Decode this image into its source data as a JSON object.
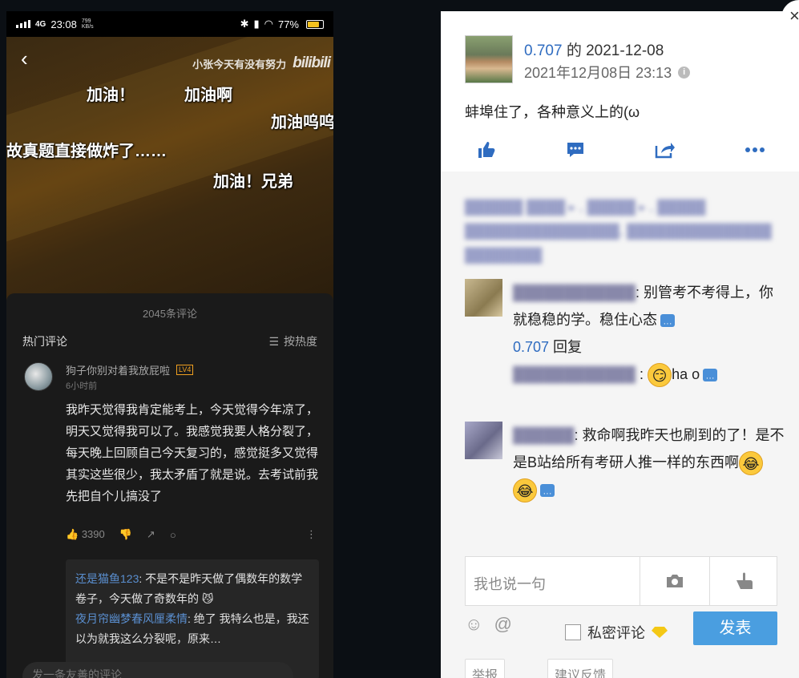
{
  "phone": {
    "status": {
      "time": "23:08",
      "signal": "4G",
      "net_speed": "799",
      "net_unit": "KB/s",
      "battery": "77%",
      "battery_level": 0.77
    },
    "video": {
      "uploader": "小张今天有没有努力",
      "brand": "bilibili",
      "danmaku": [
        "加油！",
        "加油啊",
        "加油呜呜",
        "故真题直接做炸了……",
        "加油！兄弟"
      ]
    },
    "comments": {
      "count": "2045条评论",
      "hot_label": "热门评论",
      "sort_label": "按热度",
      "main": {
        "user": "狗子你别对着我放屁啦",
        "level": "LV4",
        "time": "6小时前",
        "text": "我昨天觉得我肯定能考上，今天觉得今年凉了，明天又觉得我可以了。我感觉我要人格分裂了，每天晚上回顾自己今天复习的，感觉挺多又觉得其实这些很少，我太矛盾了就是说。去考试前我先把自个儿搞没了",
        "likes": "3390"
      },
      "replies": [
        {
          "user": "还是猫鱼123",
          "text": ": 不是不是昨天做了偶数年的数学卷子，今天做了奇数年的"
        },
        {
          "user": "夜月帘幽梦春风厘柔情",
          "text": ": 绝了 我特么也是，我还以为就我这么分裂呢，原来…"
        }
      ],
      "input_placeholder": "发一条友善的评论"
    }
  },
  "post": {
    "author_score": "0.707",
    "title_mid": " 的 ",
    "title_date": "2021-12-08",
    "datetime": "2021年12月08日 23:13",
    "text": "蚌埠住了，各种意义上的(ω",
    "comments": [
      {
        "user_blur": "████████████",
        "text": ": 别管考不考得上，你就稳稳的学。稳住心态"
      },
      {
        "reply_prefix": "0.707",
        "reply_word": " 回复"
      },
      {
        "user_blur": "████████████",
        "text": "ha o"
      },
      {
        "user_blur": "██████",
        "text": ": 救命啊我昨天也刷到的了！是不是B站给所有考研人推一样的东西啊"
      }
    ],
    "reply_placeholder": "我也说一句",
    "private_label": "私密评论",
    "post_button": "发表",
    "footer": [
      "举报",
      "建议反馈"
    ]
  }
}
